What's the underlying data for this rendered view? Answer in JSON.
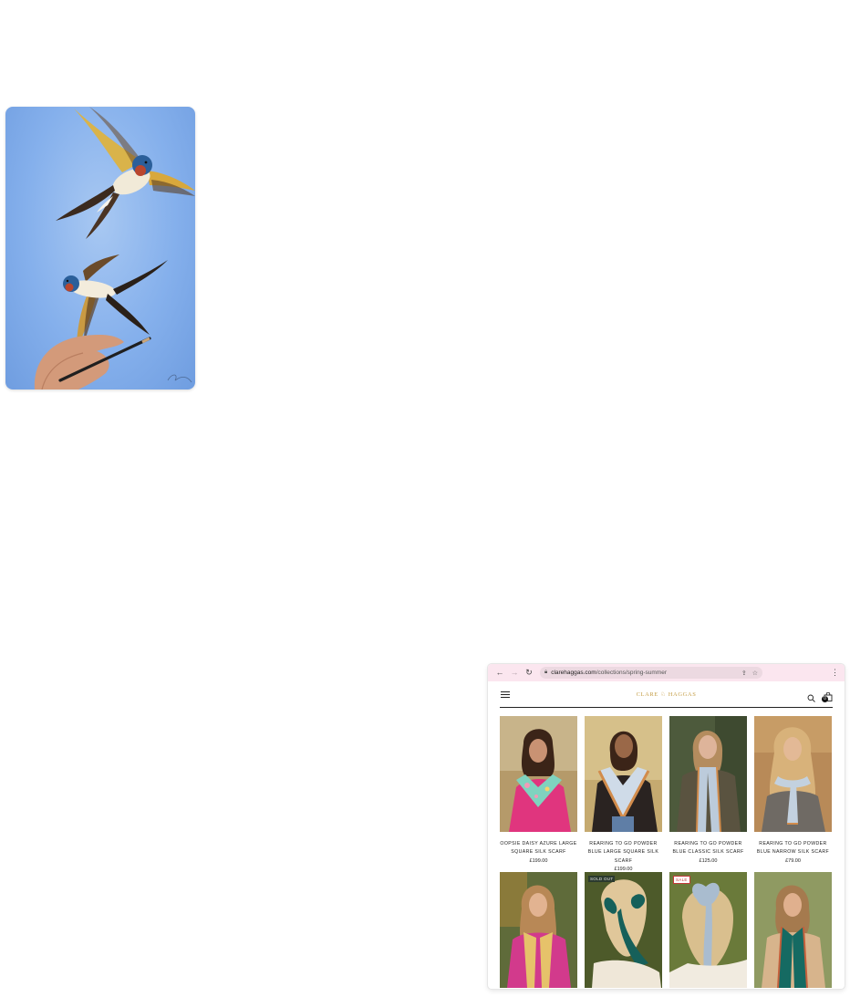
{
  "browser": {
    "url_domain": "clarehaggas.com",
    "url_path": "/collections/spring-summer"
  },
  "site": {
    "logo": "CLARE ♘ HAGGAS",
    "cart_count": "0"
  },
  "products": [
    {
      "title": "OOPSIE DAISY AZURE LARGE SQUARE SILK SCARF",
      "price": "£199.00",
      "tag": ""
    },
    {
      "title": "REARING TO GO POWDER BLUE LARGE SQUARE SILK SCARF",
      "price": "£199.00",
      "tag": ""
    },
    {
      "title": "REARING TO GO POWDER BLUE CLASSIC SILK SCARF",
      "price": "£125.00",
      "tag": ""
    },
    {
      "title": "REARING TO GO POWDER BLUE NARROW SILK SCARF",
      "price": "£79.00",
      "tag": ""
    },
    {
      "title": "",
      "price": "",
      "tag": ""
    },
    {
      "title": "",
      "price": "",
      "tag": "SOLD OUT"
    },
    {
      "title": "",
      "price": "",
      "tag": "SALE"
    },
    {
      "title": "",
      "price": "",
      "tag": ""
    }
  ],
  "colors": {
    "toolbar": "#fbe6ef",
    "logo_gold": "#c6a04b",
    "art_sky": "#85b0ec"
  }
}
